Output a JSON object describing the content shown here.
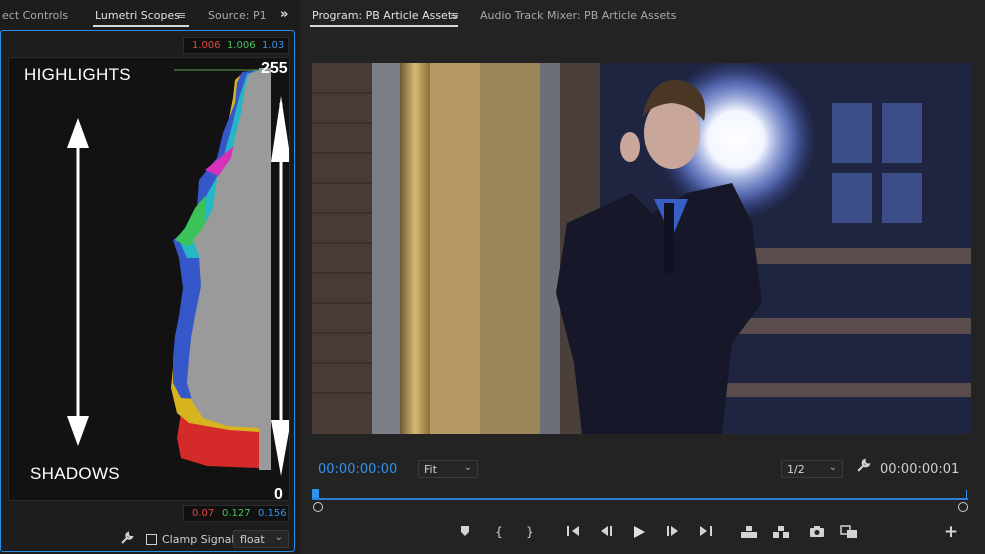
{
  "left_panel": {
    "tabs": [
      {
        "label": "ect Controls",
        "active": false
      },
      {
        "label": "Lumetri Scopes",
        "active": true
      },
      {
        "label": "Source: P1",
        "active": false
      }
    ],
    "menu_icon": "hamburger-menu-icon",
    "overflow_icon": "double-chevron-right-icon",
    "readout_top": {
      "r": "1.006",
      "g": "1.006",
      "b": "1.03"
    },
    "readout_bottom": {
      "r": "0.07",
      "g": "0.127",
      "b": "0.156"
    },
    "scope": {
      "highlights_label": "HIGHLIGHTS",
      "shadows_label": "SHADOWS",
      "scale_top": "255",
      "scale_bottom": "0"
    },
    "toolbar": {
      "wrench_icon": "wrench-icon",
      "clamp_checked": false,
      "clamp_label": "Clamp Signal",
      "precision_value": "float"
    }
  },
  "program_monitor": {
    "tabs": [
      {
        "label": "Program: PB Article Assets",
        "active": true
      },
      {
        "label": "Audio Track Mixer: PB Article Assets",
        "active": false
      }
    ],
    "menu_icon": "hamburger-menu-icon",
    "timecode_current": "00:00:00:00",
    "zoom_value": "Fit",
    "resolution_value": "1/2",
    "settings_icon": "wrench-icon",
    "timecode_duration": "00:00:00:01",
    "playhead_position": 0.0,
    "transport": [
      {
        "name": "add-marker-icon"
      },
      {
        "name": "mark-in-icon",
        "glyph": "{"
      },
      {
        "name": "mark-out-icon",
        "glyph": "}"
      },
      {
        "name": "go-to-in-icon"
      },
      {
        "name": "step-back-icon"
      },
      {
        "name": "play-icon"
      },
      {
        "name": "step-forward-icon"
      },
      {
        "name": "go-to-out-icon"
      },
      {
        "name": "lift-icon"
      },
      {
        "name": "extract-icon"
      },
      {
        "name": "export-frame-icon"
      },
      {
        "name": "comparison-view-icon"
      },
      {
        "name": "add-button-icon",
        "glyph": "+"
      }
    ]
  },
  "colors": {
    "accent_blue": "#2f93ee",
    "panel_bg": "#1d1d1d",
    "monitor_bg": "#232323",
    "red": "#e6453e",
    "green": "#48c15c",
    "blue": "#3f8fe4"
  }
}
